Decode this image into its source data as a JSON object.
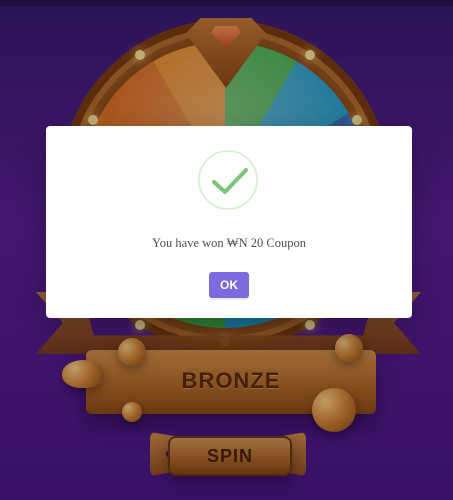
{
  "modal": {
    "message": "You have won ₩N 20 Coupon",
    "ok_label": "OK"
  },
  "badge": {
    "tier_label": "BRONZE"
  },
  "spin": {
    "label": "SPIN"
  },
  "colors": {
    "background_primary": "#5b1f96",
    "modal_bg": "#ffffff",
    "ok_button": "#7b6ae0",
    "check_green": "#7cc576"
  },
  "icons": {
    "success": "check-icon"
  }
}
